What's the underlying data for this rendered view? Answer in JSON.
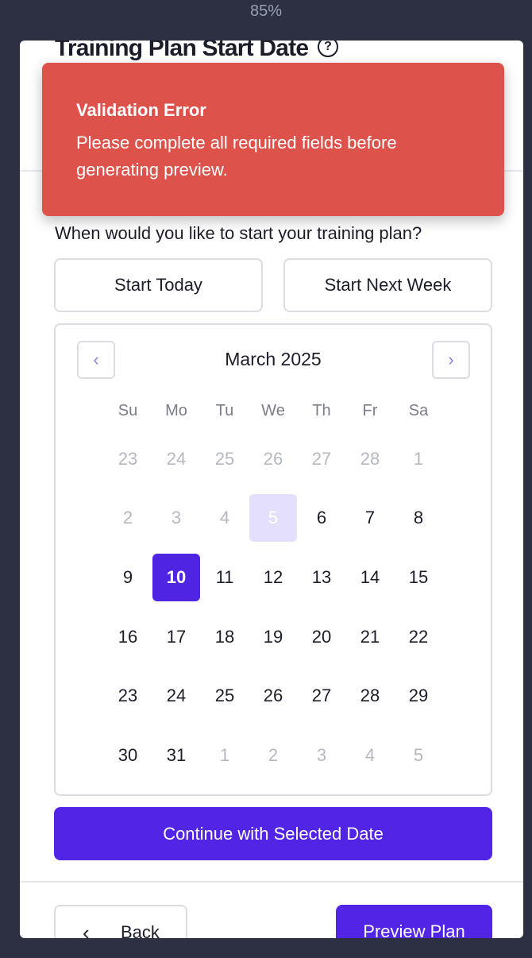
{
  "zoom": "85%",
  "page": {
    "title": "Training Plan Start Date",
    "help_icon": "question-circle-icon",
    "prompt": "When would you like to start your training plan?"
  },
  "quick_options": {
    "today_label": "Start Today",
    "next_week_label": "Start Next Week"
  },
  "calendar": {
    "month_label": "March 2025",
    "prev_icon": "chevron-left-icon",
    "next_icon": "chevron-right-icon",
    "weekdays": [
      "Su",
      "Mo",
      "Tu",
      "We",
      "Th",
      "Fr",
      "Sa"
    ],
    "weeks": [
      [
        {
          "d": "23",
          "m": true
        },
        {
          "d": "24",
          "m": true
        },
        {
          "d": "25",
          "m": true
        },
        {
          "d": "26",
          "m": true
        },
        {
          "d": "27",
          "m": true
        },
        {
          "d": "28",
          "m": true
        },
        {
          "d": "1",
          "m": true
        }
      ],
      [
        {
          "d": "2",
          "m": true
        },
        {
          "d": "3",
          "m": true
        },
        {
          "d": "4",
          "m": true
        },
        {
          "d": "5",
          "m": false,
          "state": "today"
        },
        {
          "d": "6",
          "m": false
        },
        {
          "d": "7",
          "m": false
        },
        {
          "d": "8",
          "m": false
        }
      ],
      [
        {
          "d": "9",
          "m": false
        },
        {
          "d": "10",
          "m": false,
          "state": "selected"
        },
        {
          "d": "11",
          "m": false
        },
        {
          "d": "12",
          "m": false
        },
        {
          "d": "13",
          "m": false
        },
        {
          "d": "14",
          "m": false
        },
        {
          "d": "15",
          "m": false
        }
      ],
      [
        {
          "d": "16",
          "m": false
        },
        {
          "d": "17",
          "m": false
        },
        {
          "d": "18",
          "m": false
        },
        {
          "d": "19",
          "m": false
        },
        {
          "d": "20",
          "m": false
        },
        {
          "d": "21",
          "m": false
        },
        {
          "d": "22",
          "m": false
        }
      ],
      [
        {
          "d": "23",
          "m": false
        },
        {
          "d": "24",
          "m": false
        },
        {
          "d": "25",
          "m": false
        },
        {
          "d": "26",
          "m": false
        },
        {
          "d": "27",
          "m": false
        },
        {
          "d": "28",
          "m": false
        },
        {
          "d": "29",
          "m": false
        }
      ],
      [
        {
          "d": "30",
          "m": false
        },
        {
          "d": "31",
          "m": false
        },
        {
          "d": "1",
          "m": true
        },
        {
          "d": "2",
          "m": true
        },
        {
          "d": "3",
          "m": true
        },
        {
          "d": "4",
          "m": true
        },
        {
          "d": "5",
          "m": true
        }
      ]
    ]
  },
  "actions": {
    "continue_label": "Continue with Selected Date",
    "back_label": "Back",
    "back_icon": "chevron-left-icon",
    "preview_label": "Preview Plan"
  },
  "toast": {
    "title": "Validation Error",
    "message": "Please complete all required fields before generating preview."
  },
  "colors": {
    "primary": "#5225e6",
    "error": "#dd524b",
    "today_bg": "#e4dffb",
    "backdrop": "#2c3042"
  }
}
